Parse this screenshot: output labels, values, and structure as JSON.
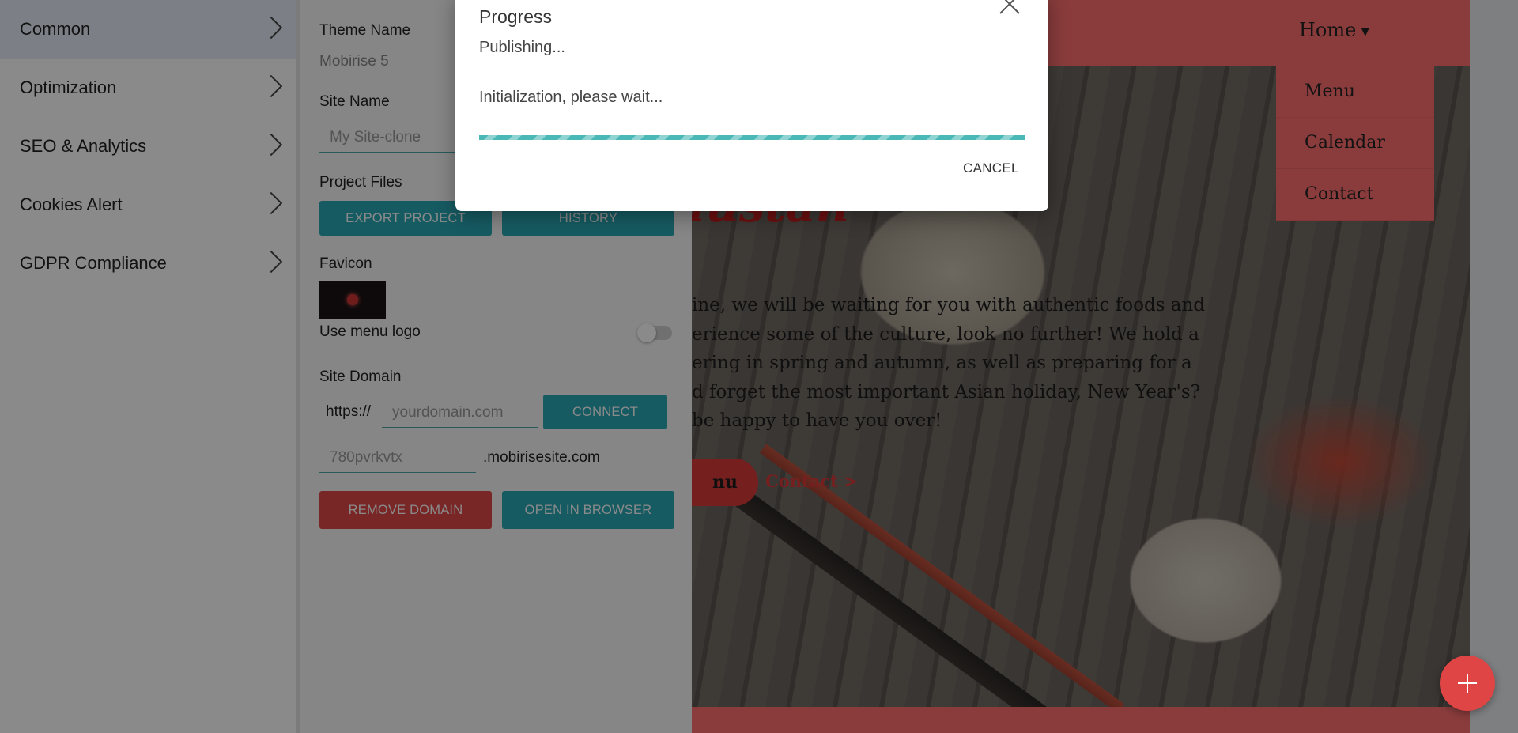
{
  "sidebar": {
    "items": [
      {
        "label": "Common",
        "active": true
      },
      {
        "label": "Optimization"
      },
      {
        "label": "SEO & Analytics"
      },
      {
        "label": "Cookies Alert"
      },
      {
        "label": "GDPR Compliance"
      }
    ]
  },
  "settings": {
    "theme_name_label": "Theme Name",
    "theme_name_value": "Mobirise 5",
    "site_name_label": "Site Name",
    "site_name_value": "My Site-clone",
    "project_files_label": "Project Files",
    "export_button": "EXPORT PROJECT",
    "history_button": "HISTORY",
    "favicon_label": "Favicon",
    "menu_logo_label": "Use menu logo",
    "menu_logo_enabled": false,
    "site_domain_label": "Site Domain",
    "domain_prefix": "https://",
    "domain_placeholder": "yourdomain.com",
    "connect_button": "CONNECT",
    "subdomain_value": "780pvrkvtx",
    "subdomain_suffix": ".mobirisesite.com",
    "remove_domain_button": "REMOVE DOMAIN",
    "open_browser_button": "OPEN IN BROWSER"
  },
  "modal": {
    "title": "Progress",
    "status": "Publishing...",
    "message": "Initialization, please wait...",
    "cancel_label": "CANCEL",
    "progress": 1.0
  },
  "preview": {
    "nav_home": "Home",
    "nav_menu_items": [
      "Menu",
      "Calendar",
      "Contact"
    ],
    "hero_script": "austan",
    "hero_text": "ine, we will be waiting for you with authentic foods and\nerience some of the culture, look no further! We hold a\nering in spring and autumn, as well as preparing for a\nd forget the most important Asian holiday, New Year's?\nbe happy to have you over!",
    "menu_button": "nu",
    "contact_link": "Contact >"
  },
  "colors": {
    "accent_teal": "#2aa8b5",
    "accent_red": "#e04747",
    "site_nav": "#ff6f6f",
    "progress": "#4bb8b8"
  },
  "icons": {
    "close": "close-icon",
    "chevron": "chevron-right-icon",
    "add": "plus-icon"
  }
}
